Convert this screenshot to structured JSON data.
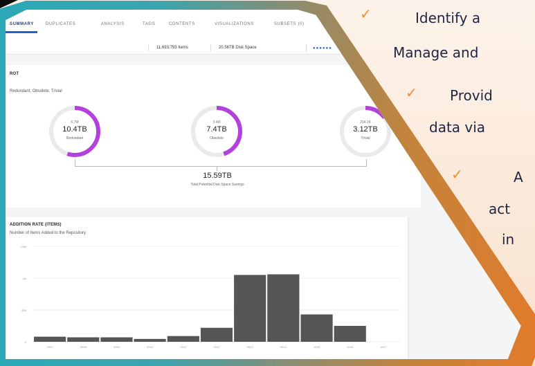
{
  "tabs": [
    "SUMMARY",
    "DUPLICATES",
    "ANALYSIS",
    "TAGS",
    "CONTENTS",
    "VISUALIZATIONS",
    "SUBSETS (0)"
  ],
  "stats": {
    "items": "11,693,793 Items",
    "disk": "20.56TB Disk Space",
    "more": "●●●●●●"
  },
  "rot": {
    "title": "ROT",
    "subtitle": "Redundant, Obsolete, Trivial",
    "donuts": [
      {
        "count": "6.7M",
        "size": "10.4TB",
        "label": "Redundant",
        "fraction": 0.55
      },
      {
        "count": "3.4M",
        "size": "7.4TB",
        "label": "Obsolete",
        "fraction": 0.45
      },
      {
        "count": "204.3K",
        "size": "3.12TB",
        "label": "Trivial",
        "fraction": 0.15
      }
    ],
    "total_value": "15.59TB",
    "total_label": "Total Potential Disk Space Savings"
  },
  "addition": {
    "title": "ADDITION RATE (ITEMS)",
    "subtitle": "Number of Items Added to the Repository"
  },
  "chart_data": {
    "type": "bar",
    "categories": [
      "2007",
      "2008",
      "2009",
      "2010",
      "2011",
      "2012",
      "2013",
      "2014",
      "2015",
      "2016",
      "2017"
    ],
    "values": [
      80,
      70,
      70,
      45,
      90,
      220,
      1050,
      1060,
      430,
      250,
      0
    ],
    "ylim": [
      0,
      1500
    ],
    "yticks": [
      "1.5M",
      "1M",
      "500",
      "0"
    ],
    "color": "#555555"
  },
  "bullets": [
    "Identify a",
    "Manage and",
    "Provid",
    "data via",
    "A",
    "act",
    "in"
  ],
  "colors": {
    "accent": "#ef8c2c",
    "donut": "#b441dc",
    "frame_left": "#2ba9b8",
    "frame_right": "#e47a2a"
  }
}
